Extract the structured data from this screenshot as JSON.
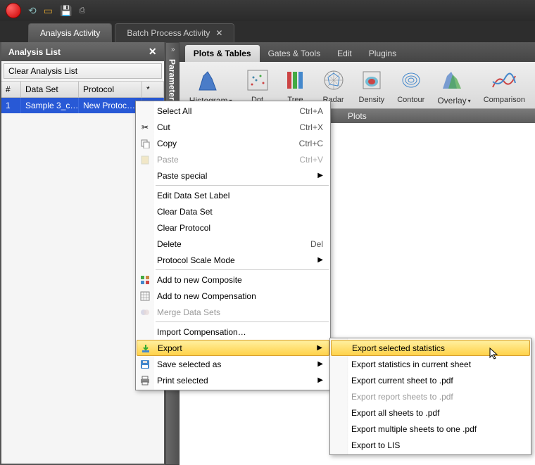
{
  "tabs": {
    "active": "Analysis Activity",
    "other": "Batch Process Activity"
  },
  "left_panel": {
    "title": "Analysis List",
    "clear_button": "Clear Analysis List",
    "columns": {
      "c1": "#",
      "c2": "Data Set",
      "c3": "Protocol",
      "c4": "*"
    },
    "row": {
      "c1": "1",
      "c2": "Sample 3_c…",
      "c3": "New Protoc…",
      "c4": "*"
    }
  },
  "vertical_panel": "Parameters",
  "ribbon": {
    "tabs": {
      "t1": "Plots & Tables",
      "t2": "Gates & Tools",
      "t3": "Edit",
      "t4": "Plugins"
    },
    "buttons": {
      "b1": "Histogram",
      "b2": "Dot",
      "b3": "Tree",
      "b4": "Radar",
      "b5": "Density",
      "b6": "Contour",
      "b7": "Overlay",
      "b8": "Comparison"
    },
    "group": "Plots"
  },
  "context_menu": {
    "select_all": "Select All",
    "select_all_key": "Ctrl+A",
    "cut": "Cut",
    "cut_key": "Ctrl+X",
    "copy": "Copy",
    "copy_key": "Ctrl+C",
    "paste": "Paste",
    "paste_key": "Ctrl+V",
    "paste_special": "Paste special",
    "edit_label": "Edit Data Set Label",
    "clear_dataset": "Clear Data Set",
    "clear_protocol": "Clear Protocol",
    "delete": "Delete",
    "delete_key": "Del",
    "scale_mode": "Protocol Scale Mode",
    "add_composite": "Add to new Composite",
    "add_compensation": "Add to new Compensation",
    "merge": "Merge Data Sets",
    "import_comp": "Import Compensation…",
    "export": "Export",
    "save_as": "Save selected as",
    "print": "Print selected"
  },
  "submenu": {
    "s1": "Export selected statistics",
    "s2": "Export statistics in current sheet",
    "s3": "Export current sheet to .pdf",
    "s4": "Export report sheets to .pdf",
    "s5": "Export all sheets to .pdf",
    "s6": "Export multiple sheets to one .pdf",
    "s7": "Export to LIS"
  }
}
